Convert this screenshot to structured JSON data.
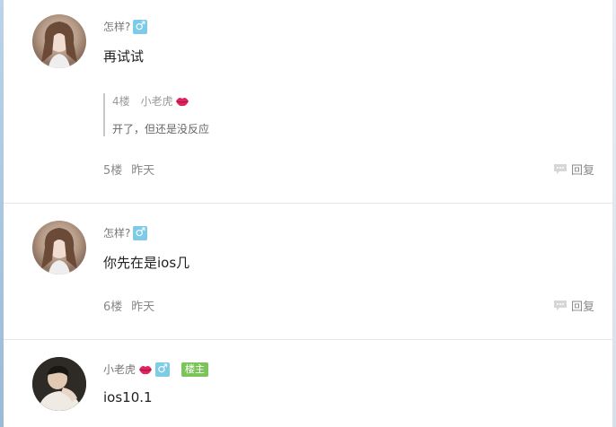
{
  "comments": [
    {
      "user": "怎样?",
      "gender_icon": "♂",
      "text": "再试试",
      "quote": {
        "floor": "4楼",
        "user": "小老虎",
        "text": "开了，但还是没反应"
      },
      "floor": "5楼",
      "time": "昨天",
      "reply_label": "回复"
    },
    {
      "user": "怎样?",
      "gender_icon": "♂",
      "text": "你先在是ios几",
      "floor": "6楼",
      "time": "昨天",
      "reply_label": "回复"
    },
    {
      "user": "小老虎",
      "gender_icon": "♂",
      "owner_badge": "楼主",
      "text": "ios10.1"
    }
  ],
  "colors": {
    "gender_badge": "#7ecbe8",
    "owner_badge": "#7cc359",
    "lips": "#e0245e"
  }
}
